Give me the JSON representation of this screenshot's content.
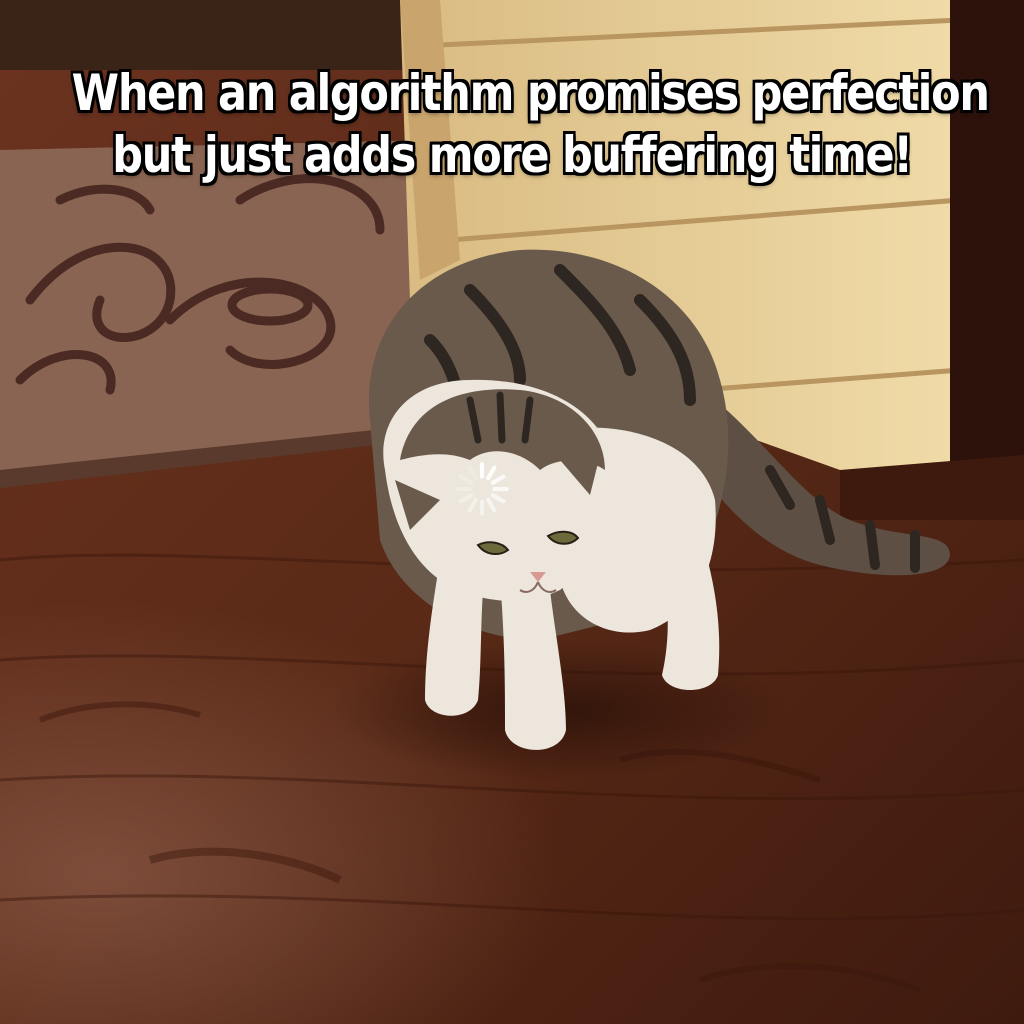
{
  "meme": {
    "caption_lines": [
      "When an algorithm promises perfection",
      "but just adds more buffering time!"
    ]
  },
  "scene": {
    "subject": "tabby-and-white cat hunched over with loading spinner on forehead",
    "colors": {
      "floor": "#5a2a17",
      "floor_highlight": "#7a3f25",
      "cabinet": "#e8cf9a",
      "rug": "#8a6452",
      "rug_pattern": "#4a2a22",
      "cat_white": "#ece6dc",
      "cat_tabby": "#5d4f44",
      "spinner": "#ffffff",
      "caption_text": "#ffffff",
      "caption_outline": "#000000"
    },
    "icons": [
      "loading-spinner-icon"
    ]
  }
}
